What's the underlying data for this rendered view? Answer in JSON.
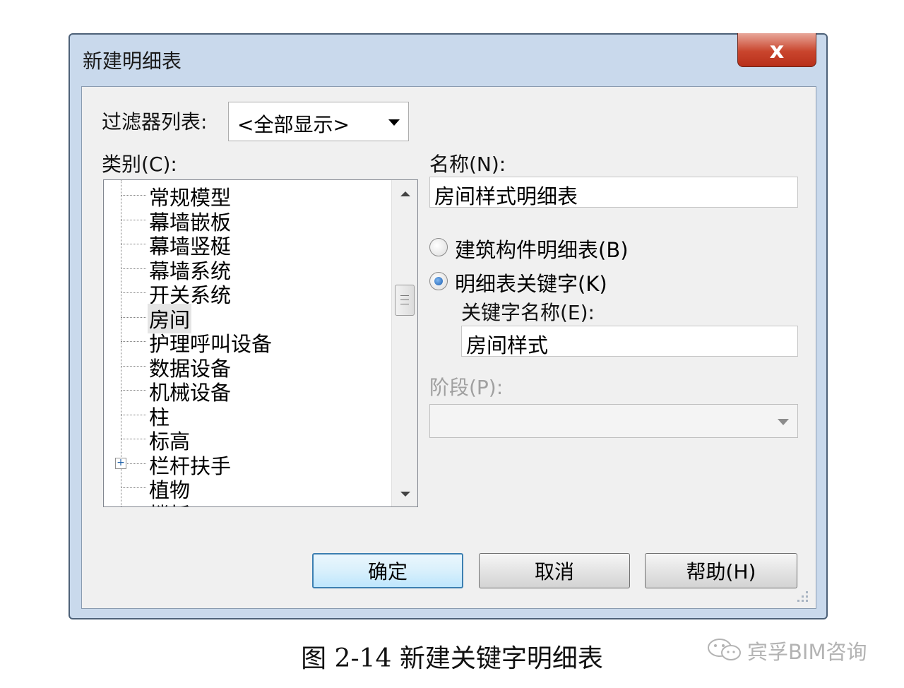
{
  "dialog": {
    "title": "新建明细表",
    "close_label": "x"
  },
  "filter": {
    "label": "过滤器列表:",
    "value": "<全部显示>"
  },
  "category": {
    "label": "类别(C):",
    "items": [
      {
        "label": "常规模型"
      },
      {
        "label": "幕墙嵌板"
      },
      {
        "label": "幕墙竖梃"
      },
      {
        "label": "幕墙系统"
      },
      {
        "label": "开关系统"
      },
      {
        "label": "房间",
        "selected": true
      },
      {
        "label": "护理呼叫设备"
      },
      {
        "label": "数据设备"
      },
      {
        "label": "机械设备"
      },
      {
        "label": "柱"
      },
      {
        "label": "标高"
      },
      {
        "label": "栏杆扶手",
        "expandable": true
      },
      {
        "label": "植物"
      },
      {
        "label": "楼板",
        "expandable": true
      }
    ]
  },
  "name": {
    "label": "名称(N):",
    "value": "房间样式明细表"
  },
  "options": {
    "building_component": "建筑构件明细表(B)",
    "schedule_key": "明细表关键字(K)",
    "selected": "schedule_key"
  },
  "key_name": {
    "label": "关键字名称(E):",
    "value": "房间样式"
  },
  "phase": {
    "label": "阶段(P):",
    "value": ""
  },
  "buttons": {
    "ok": "确定",
    "cancel": "取消",
    "help": "帮助(H)"
  },
  "caption": "图 2-14 新建关键字明细表",
  "watermark": "宾孚BIM咨询"
}
